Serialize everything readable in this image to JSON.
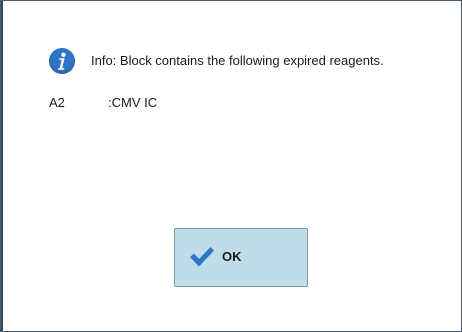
{
  "dialog": {
    "message": "Info: Block contains the following expired reagents.",
    "icon": "info-icon",
    "reagents": [
      {
        "position": "A2",
        "name": ":CMV IC"
      }
    ],
    "ok_button": {
      "label": "OK",
      "icon": "checkmark-icon"
    }
  },
  "colors": {
    "info_icon": "#2f74c6",
    "button_bg": "#bfdde8",
    "checkmark": "#2f74c6"
  }
}
